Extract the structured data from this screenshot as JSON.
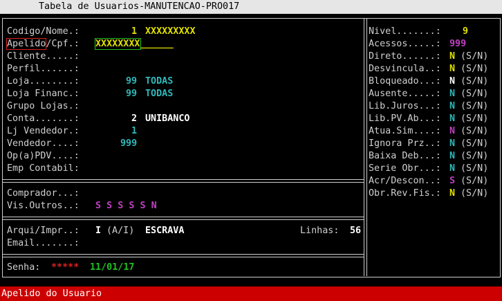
{
  "window": {
    "title": "Tabela de Usuarios-MANUTENCAO-PRO017"
  },
  "left": {
    "codigo": {
      "label": "Codigo/Nome.:",
      "code": "1",
      "name": "XXXXXXXXX"
    },
    "apelido": {
      "label": "Apelido",
      "sep": "/Cpf.:",
      "value": "XXXXXXXX",
      "rest": "______"
    },
    "cliente": {
      "label": "Cliente.....:"
    },
    "perfil": {
      "label": "Perfil......:"
    },
    "loja": {
      "label": "Loja........:",
      "code": "99",
      "name": "TODAS"
    },
    "loja_financ": {
      "label": "Loja Financ.:",
      "code": "99",
      "name": "TODAS"
    },
    "grupo_lojas": {
      "label": "Grupo Lojas.:"
    },
    "conta": {
      "label": "Conta.......:",
      "code": "2",
      "name": "UNIBANCO"
    },
    "lj_vendedor": {
      "label": "Lj Vendedor.:",
      "code": "1"
    },
    "vendedor": {
      "label": "Vendedor....:",
      "code": "999"
    },
    "op_pdv": {
      "label": "Op(a)PDV....:"
    },
    "emp_contabil": {
      "label": "Emp Contabil:"
    },
    "comprador": {
      "label": "Comprador...:"
    },
    "vis_outros": {
      "label": "Vis.Outros..:",
      "value": "S S S S S N"
    },
    "arqui": {
      "label": "Arqui/Impr..:",
      "value": "I",
      "hint": "(A/I)",
      "name": "ESCRAVA"
    },
    "linhas": {
      "label": "Linhas:",
      "value": "56"
    },
    "email": {
      "label": "Email.......:"
    },
    "senha": {
      "label": "Senha:",
      "mask": "*****",
      "date": "11/01/17"
    }
  },
  "right": {
    "nivel": {
      "label": "Nivel.......:",
      "value": "9"
    },
    "acessos": {
      "label": "Acessos.....:",
      "value": "999"
    },
    "direto": {
      "label": "Direto......:",
      "value": "N",
      "hint": "(S/N)"
    },
    "desvincula": {
      "label": "Desvincula..:",
      "value": "N",
      "hint": "(S/N)"
    },
    "bloqueado": {
      "label": "Bloqueado...:",
      "value": "N",
      "hint": "(S/N)"
    },
    "ausente": {
      "label": "Ausente.....:",
      "value": "N",
      "hint": "(S/N)"
    },
    "lib_juros": {
      "label": "Lib.Juros...:",
      "value": "N",
      "hint": "(S/N)"
    },
    "lib_pv": {
      "label": "Lib.PV.Ab...:",
      "value": "N",
      "hint": "(S/N)"
    },
    "atua_sim": {
      "label": "Atua.Sim....:",
      "value": "N",
      "hint": "(S/N)"
    },
    "ignora_prz": {
      "label": "Ignora Prz..:",
      "value": "N",
      "hint": "(S/N)"
    },
    "baixa_deb": {
      "label": "Baixa Deb...:",
      "value": "N",
      "hint": "(S/N)"
    },
    "serie_obr": {
      "label": "Serie Obr...:",
      "value": "N",
      "hint": "(S/N)"
    },
    "acr_descon": {
      "label": "Acr/Descon..:",
      "value": "S",
      "hint": "(S/N)"
    },
    "obr_rev_fis": {
      "label": "Obr.Rev.Fis.:",
      "value": "N",
      "hint": "(S/N)"
    }
  },
  "status": {
    "message": "Apelido do Usuario"
  }
}
